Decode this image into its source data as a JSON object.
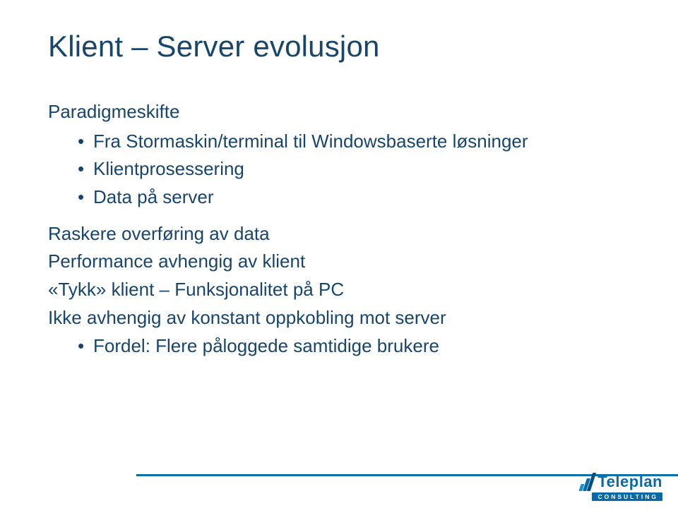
{
  "slide": {
    "title": "Klient – Server evolusjon",
    "paradigm_heading": "Paradigmeskifte",
    "paradigm_bullets": [
      "Fra Stormaskin/terminal til Windowsbaserte løsninger",
      "Klientprosessering",
      "Data på server"
    ],
    "line1": "Raskere overføring av data",
    "line2": "Performance avhengig av klient",
    "line3": "«Tykk» klient – Funksjonalitet på PC",
    "line4": "Ikke avhengig av konstant oppkobling mot server",
    "line4_bullets": [
      "Fordel: Flere påloggede samtidige brukere"
    ]
  },
  "brand": {
    "name": "Teleplan",
    "sub": "CONSULTING"
  },
  "colors": {
    "text": "#18456b",
    "accent": "#0070a8",
    "brand_blue": "#0a6aa6"
  }
}
